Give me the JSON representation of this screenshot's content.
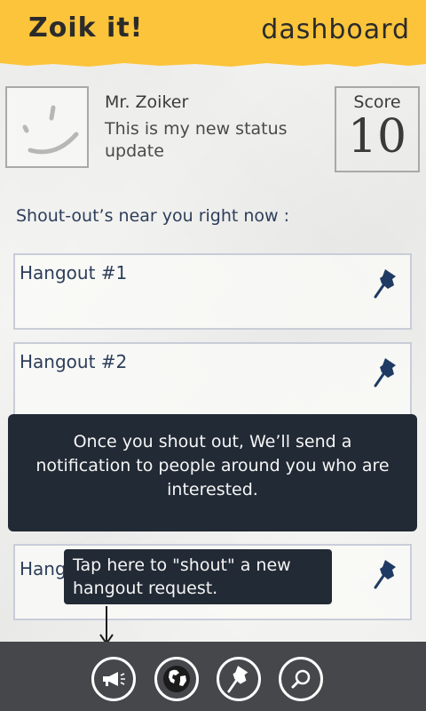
{
  "header": {
    "app_title": "Zoik it!",
    "page_title": "dashboard"
  },
  "profile": {
    "name": "Mr. Zoiker",
    "status": "This is my new status update",
    "score_label": "Score",
    "score_value": "10"
  },
  "section_label": "Shout-out’s near you right now :",
  "hangouts": [
    {
      "title": "Hangout #1"
    },
    {
      "title": "Hangout #2"
    },
    {
      "title": "Hang"
    }
  ],
  "tips": {
    "overlay": "Once you shout out, We’ll send a notification to people around you who are interested.",
    "shout_hint": "Tap here to \"shout\" a new hangout request."
  },
  "bottom_nav": [
    {
      "icon": "megaphone-icon"
    },
    {
      "icon": "globe-icon"
    },
    {
      "icon": "pin-icon"
    },
    {
      "icon": "search-icon"
    }
  ],
  "colors": {
    "header": "#fcc43a",
    "tip_bg": "#222a35",
    "bar": "#46474b",
    "text_blue": "#2d3e5a"
  }
}
